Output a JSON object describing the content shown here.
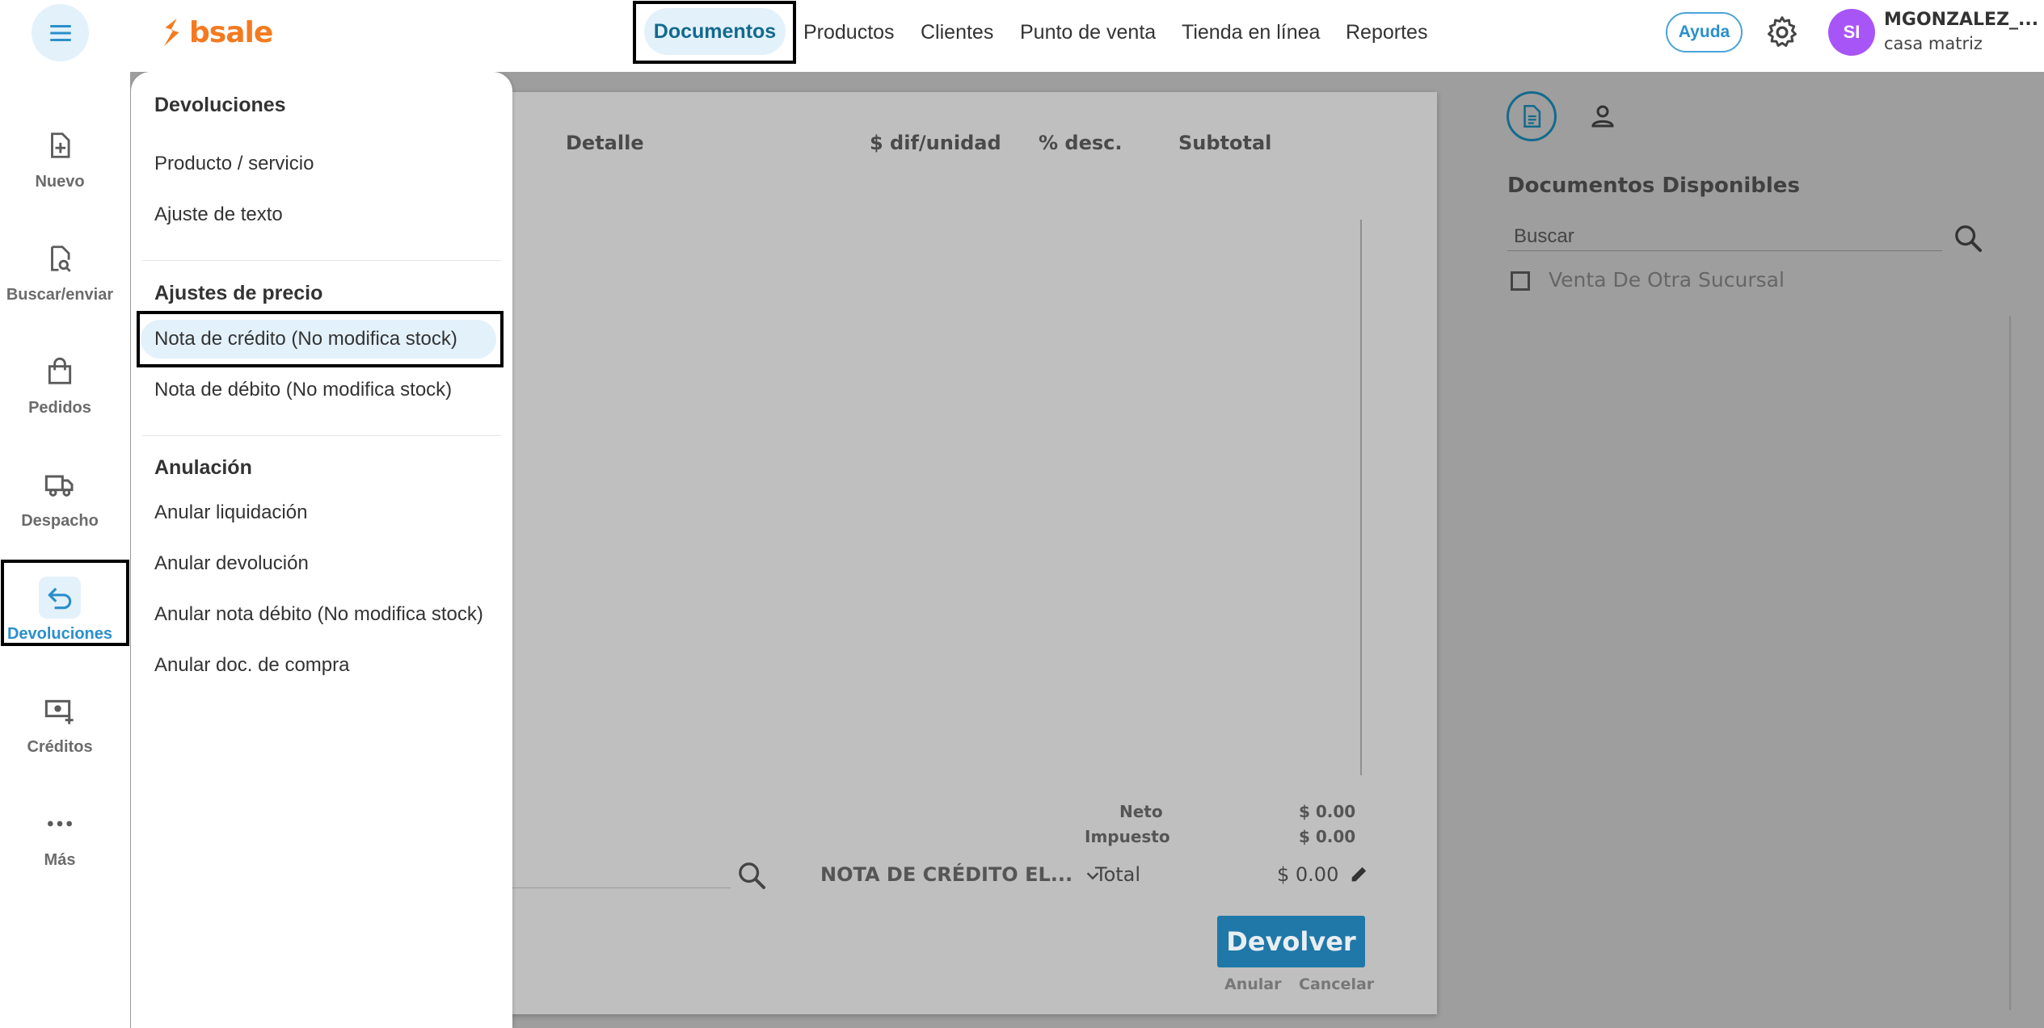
{
  "header": {
    "logo_text": "bsale",
    "nav": [
      {
        "label": "Documentos",
        "active": true
      },
      {
        "label": "Productos"
      },
      {
        "label": "Clientes"
      },
      {
        "label": "Punto de venta"
      },
      {
        "label": "Tienda en línea"
      },
      {
        "label": "Reportes"
      }
    ],
    "help_label": "Ayuda",
    "user_initials": "SI",
    "user_name": "MGONZALEZ_...",
    "user_branch": "casa matriz"
  },
  "sidebar": {
    "items": [
      {
        "label": "Nuevo",
        "icon": "file-plus-icon"
      },
      {
        "label": "Buscar/enviar",
        "icon": "file-search-icon"
      },
      {
        "label": "Pedidos",
        "icon": "shopping-bag-icon"
      },
      {
        "label": "Despacho",
        "icon": "truck-icon"
      },
      {
        "label": "Devoluciones",
        "icon": "return-arrow-icon",
        "active": true
      },
      {
        "label": "Créditos",
        "icon": "cash-plus-icon"
      },
      {
        "label": "Más",
        "icon": "more-dots-icon"
      }
    ]
  },
  "dropdown": {
    "sections": [
      {
        "title": "Devoluciones",
        "items": [
          "Producto / servicio",
          "Ajuste de texto"
        ]
      },
      {
        "title": "Ajustes de precio",
        "items": [
          "Nota de crédito (No modifica stock)",
          "Nota de débito (No modifica stock)"
        ]
      },
      {
        "title": "Anulación",
        "items": [
          "Anular liquidación",
          "Anular devolución",
          "Anular nota débito (No modifica stock)",
          "Anular doc. de compra"
        ]
      }
    ],
    "selected_item": "Nota de crédito (No modifica stock)"
  },
  "document": {
    "columns": [
      "Detalle",
      "$ dif/unidad",
      "% desc.",
      "Subtotal"
    ],
    "neto_label": "Neto",
    "neto_value": "$ 0.00",
    "impuesto_label": "Impuesto",
    "impuesto_value": "$ 0.00",
    "total_label": "Total",
    "total_value": "$ 0.00",
    "doc_type": "NOTA DE CRÉDITO EL...",
    "devolver_label": "Devolver",
    "anular_label": "Anular",
    "cancelar_label": "Cancelar"
  },
  "right_panel": {
    "title": "Documentos Disponibles",
    "search_placeholder": "Buscar",
    "checkbox_label": "Venta De Otra Sucursal"
  },
  "colors": {
    "brand": "#f47a20",
    "accent": "#136a8e",
    "active_bg": "#e3f1fb",
    "avatar": "#a855f7",
    "primary_button": "#1f78a8"
  }
}
